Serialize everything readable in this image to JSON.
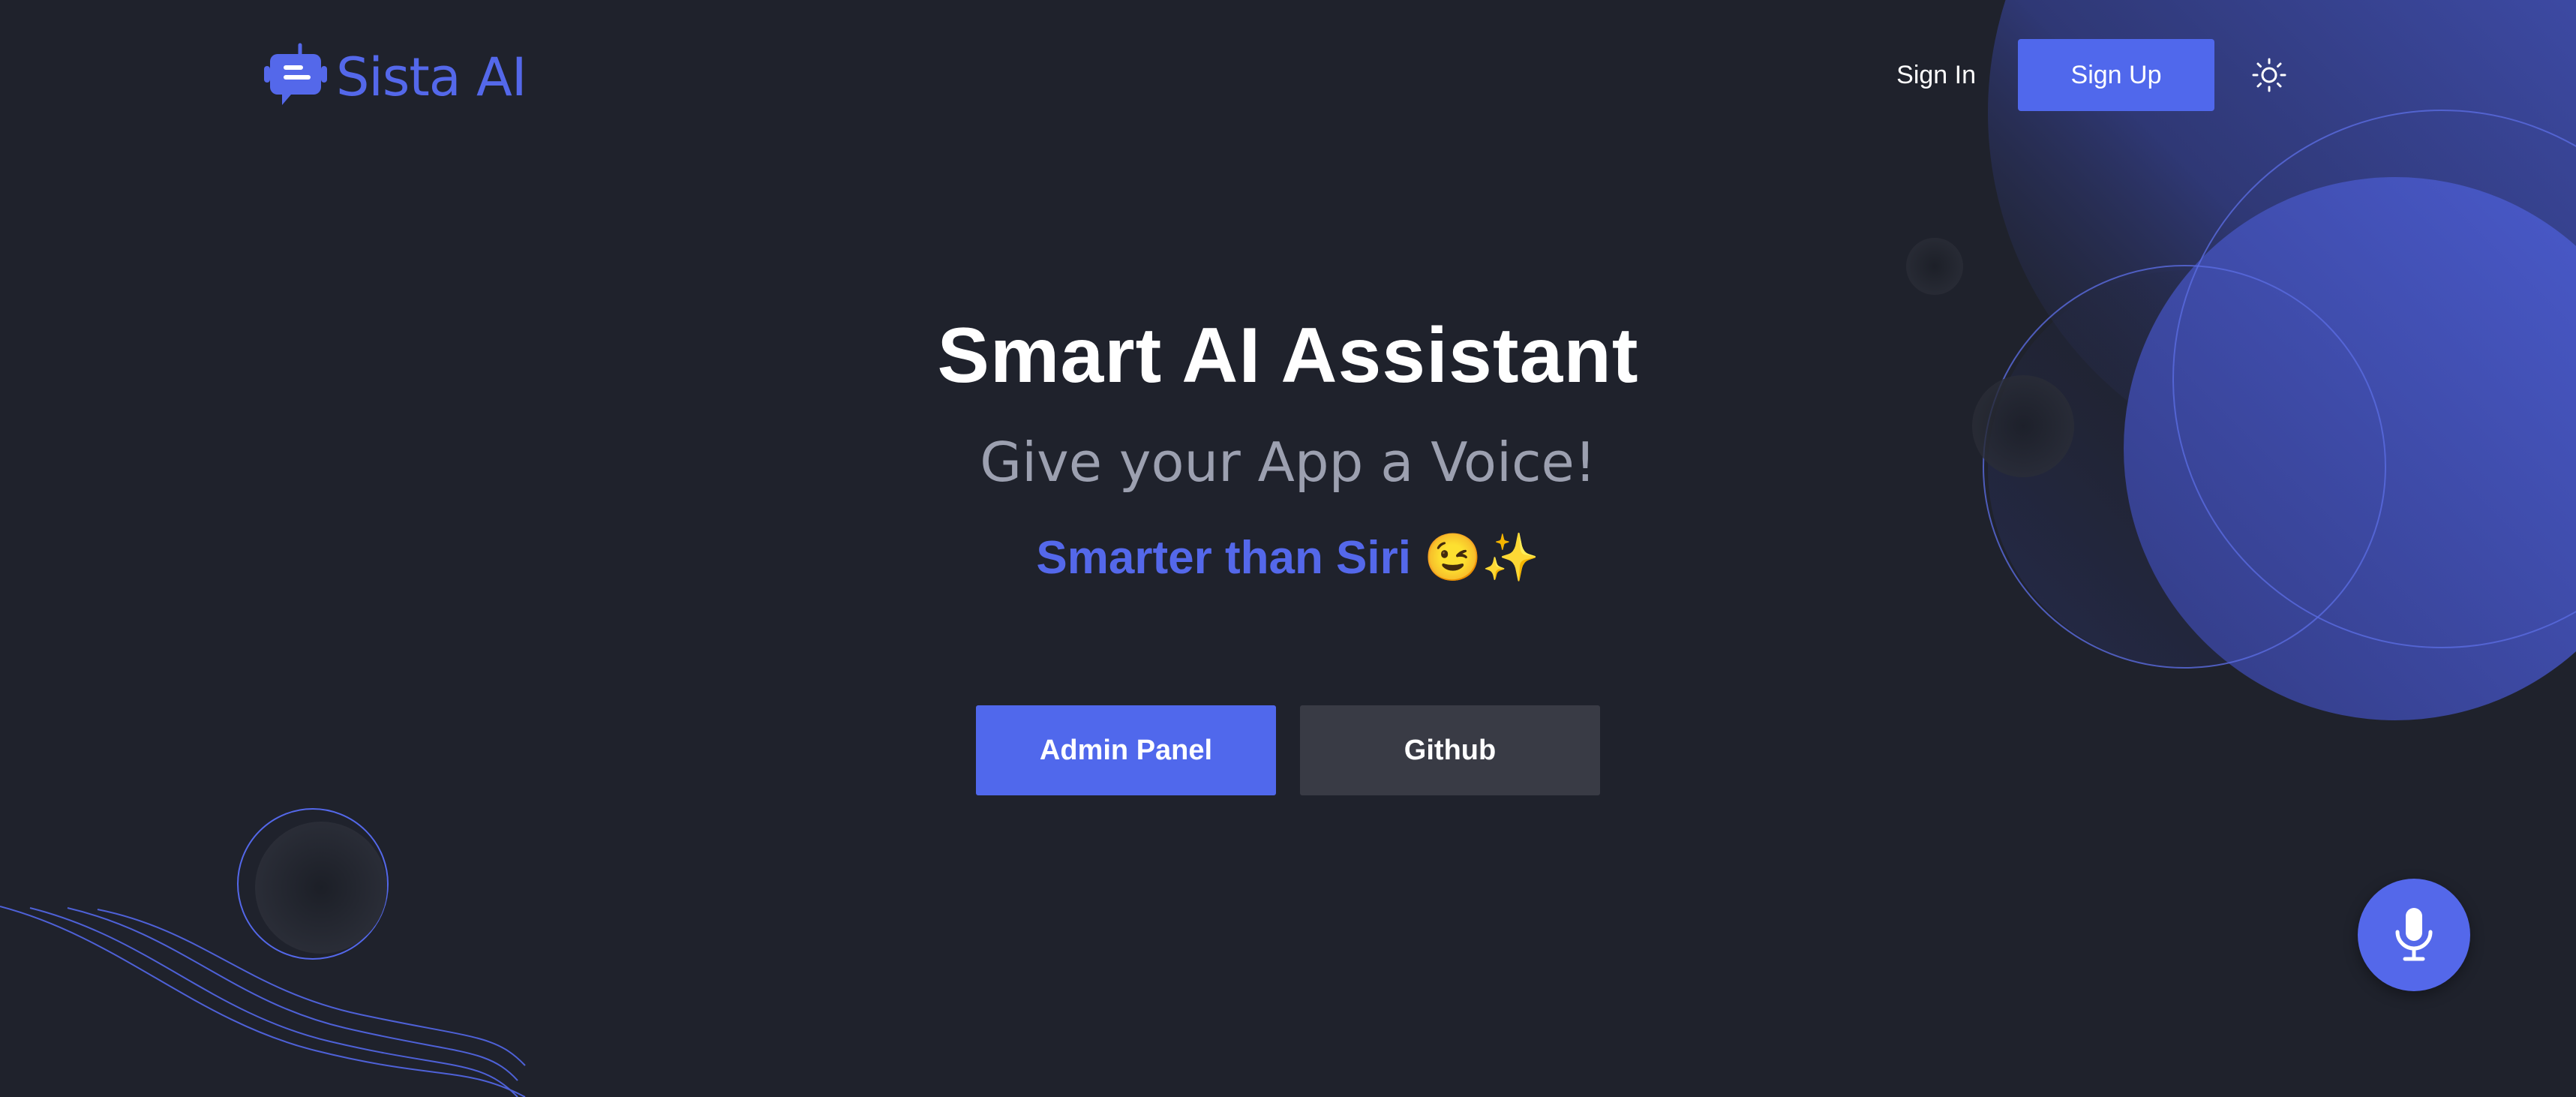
{
  "brand": {
    "name": "Sista AI",
    "accent_color": "#5468ea",
    "logo_icon": "chat-robot-icon"
  },
  "nav": {
    "signin_label": "Sign In",
    "signup_label": "Sign Up",
    "theme_toggle_icon": "sun-icon"
  },
  "hero": {
    "title": "Smart AI Assistant",
    "subtitle": "Give your App a Voice!",
    "tagline": "Smarter than Siri",
    "tagline_emoji": "😉✨"
  },
  "cta": {
    "primary_label": "Admin Panel",
    "secondary_label": "Github"
  },
  "fab": {
    "icon": "microphone-icon"
  },
  "colors": {
    "background": "#1f222c",
    "primary": "#5068ec",
    "secondary_button": "#393b45",
    "subtitle_text": "#9ca0b0"
  }
}
